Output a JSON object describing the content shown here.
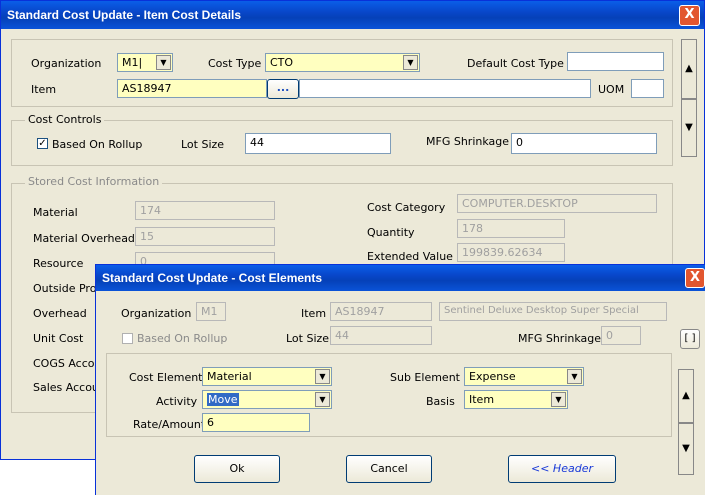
{
  "main": {
    "title": "Standard Cost Update - Item Cost Details",
    "close": "X",
    "labels": {
      "organization": "Organization",
      "cost_type": "Cost Type",
      "default_cost_type": "Default Cost Type",
      "item": "Item",
      "uom": "UOM"
    },
    "values": {
      "organization": "M1|",
      "cost_type": "CTO",
      "default_cost_type": "",
      "item": "AS18947",
      "item_description": "",
      "uom": "",
      "lov_button": "..."
    },
    "cost_controls": {
      "title": "Cost Controls",
      "based_on_rollup": "Based On Rollup",
      "based_on_rollup_checked": true,
      "lot_size_label": "Lot Size",
      "lot_size": "44",
      "mfg_shrinkage_label": "MFG Shrinkage",
      "mfg_shrinkage": "0"
    },
    "stored_cost": {
      "title": "Stored Cost Information",
      "rows": [
        {
          "label": "Material",
          "value": "174"
        },
        {
          "label": "Material Overhead",
          "value": "15"
        },
        {
          "label": "Resource",
          "value": "0"
        },
        {
          "label": "Outside Proc",
          "value": ""
        },
        {
          "label": "Overhead",
          "value": ""
        },
        {
          "label": "Unit Cost",
          "value": ""
        },
        {
          "label": "COGS Accou",
          "value": ""
        },
        {
          "label": "Sales Accour",
          "value": ""
        }
      ],
      "cost_category_label": "Cost Category",
      "cost_category": "COMPUTER.DESKTOP",
      "quantity_label": "Quantity",
      "quantity": "178",
      "extended_value_label": "Extended Value",
      "extended_value": "199839.62634"
    },
    "scroll_up": "▲",
    "scroll_down": "▼"
  },
  "dialog": {
    "title": "Standard Cost Update - Cost Elements",
    "close": "X",
    "organization_label": "Organization",
    "organization": "M1",
    "item_label": "Item",
    "item": "AS18947",
    "item_description": "Sentinel Deluxe Desktop Super Special",
    "based_on_rollup": "Based On Rollup",
    "lot_size_label": "Lot Size",
    "lot_size": "44",
    "mfg_shrinkage_label": "MFG Shrinkage",
    "mfg_shrinkage": "0",
    "bracket_button": "[ ]",
    "cost_element_label": "Cost Element",
    "cost_element": "Material",
    "sub_element_label": "Sub Element",
    "sub_element": "Expense",
    "activity_label": "Activity",
    "activity": "Move",
    "basis_label": "Basis",
    "basis": "Item",
    "rate_label": "Rate/Amount",
    "rate": "6",
    "ok": "Ok",
    "cancel": "Cancel",
    "header": "<< Header",
    "scroll_up": "▲",
    "scroll_down": "▼"
  }
}
